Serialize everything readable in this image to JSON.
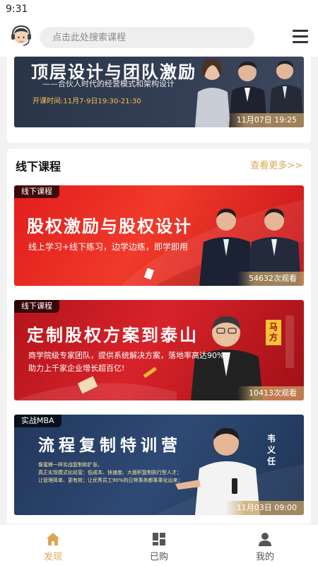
{
  "status_bar": {
    "time": "9:31"
  },
  "header": {
    "search_placeholder": "点击此处搜索课程"
  },
  "featured": {
    "title": "顶层设计与团队激励",
    "subtitle": "——合伙人时代的经营模式和架构设计",
    "schedule": "开课时间:11月7-9日19:30-21:30",
    "date": "11月07日 19:25"
  },
  "offline_section": {
    "title": "线下课程",
    "more": "查看更多>>",
    "courses": [
      {
        "tag": "线下课程",
        "title": "股权激励与股权设计",
        "subtitle": "线上学习+线下练习，边学边练，即学即用",
        "views": "54632次观看"
      },
      {
        "tag": "线下课程",
        "title": "定制股权方案到泰山",
        "subtitle_1": "商学院级专家团队，提供系统解决方案，落地率高达90%",
        "subtitle_2": "助力上千家企业增长超百亿!",
        "teacher": "马方",
        "views": "10413次观看"
      },
      {
        "tag": "实战MBA",
        "title": "流程复制特训营",
        "line_1": "像蜜蜂一样实战复制和扩张，",
        "line_2": "真正实现模式化经营：低成本、快速度、大面积复制执行型人才；",
        "line_3": "让管理简单、更有效；让优秀员工90%的日常事务都事事化出来；",
        "teacher": "韦义任",
        "date": "11月03日 09:00"
      }
    ]
  },
  "tabbar": {
    "items": [
      {
        "label": "发现",
        "icon": "home-icon",
        "active": true
      },
      {
        "label": "已购",
        "icon": "grid-icon",
        "active": false
      },
      {
        "label": "我的",
        "icon": "person-icon",
        "active": false
      }
    ]
  },
  "colors": {
    "accent": "#d9a756",
    "schedule_text": "#f4c24c"
  }
}
